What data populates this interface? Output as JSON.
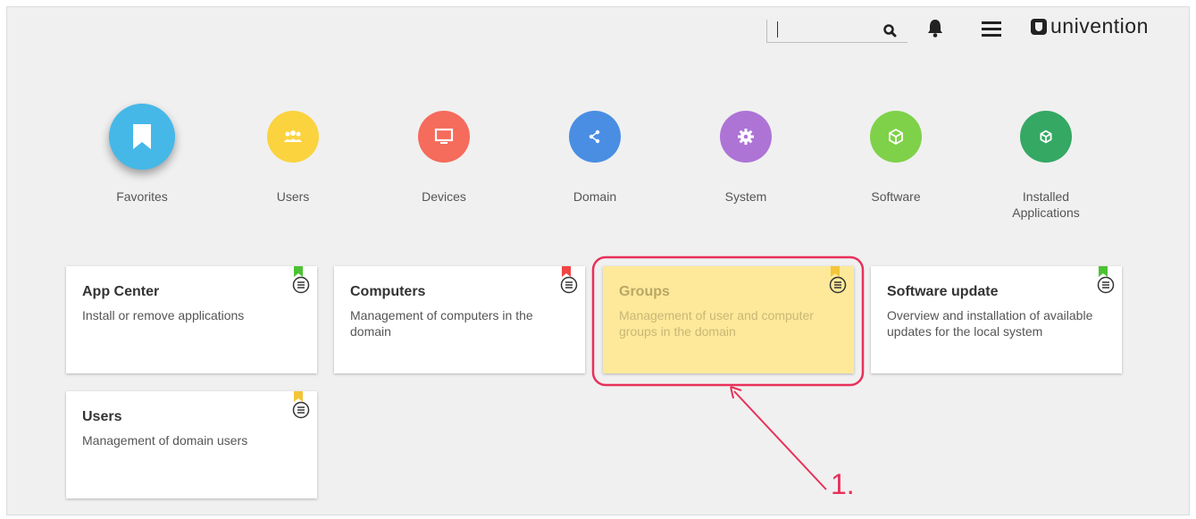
{
  "header": {
    "search": {
      "value": "",
      "placeholder": ""
    },
    "logo_text": "univention"
  },
  "categories": [
    {
      "label": "Favorites",
      "color": "#45b8e8",
      "icon": "bookmark-icon"
    },
    {
      "label": "Users",
      "color": "#fbd33f",
      "icon": "users-icon"
    },
    {
      "label": "Devices",
      "color": "#f56b5c",
      "icon": "monitor-icon"
    },
    {
      "label": "Domain",
      "color": "#4a8ee3",
      "icon": "network-icon"
    },
    {
      "label": "System",
      "color": "#ad74d6",
      "icon": "gear-icon"
    },
    {
      "label": "Software",
      "color": "#7fd149",
      "icon": "box-icon"
    },
    {
      "label": "Installed Applications",
      "color": "#35a864",
      "icon": "box-icon"
    }
  ],
  "tiles": [
    {
      "title": "App Center",
      "description": "Install or remove applications",
      "bookmark_color": "#4cc233"
    },
    {
      "title": "Computers",
      "description": "Management of computers in the domain",
      "bookmark_color": "#f14545"
    },
    {
      "title": "Groups",
      "description": "Management of user and computer groups in the domain",
      "bookmark_color": "#f2c53a",
      "highlighted": true
    },
    {
      "title": "Software update",
      "description": "Overview and installation of available updates for the local system",
      "bookmark_color": "#4cc233"
    },
    {
      "title": "Users",
      "description": "Management of domain users",
      "bookmark_color": "#f2c53a"
    }
  ],
  "annotation": {
    "label": "1.",
    "color": "#e8305a"
  }
}
